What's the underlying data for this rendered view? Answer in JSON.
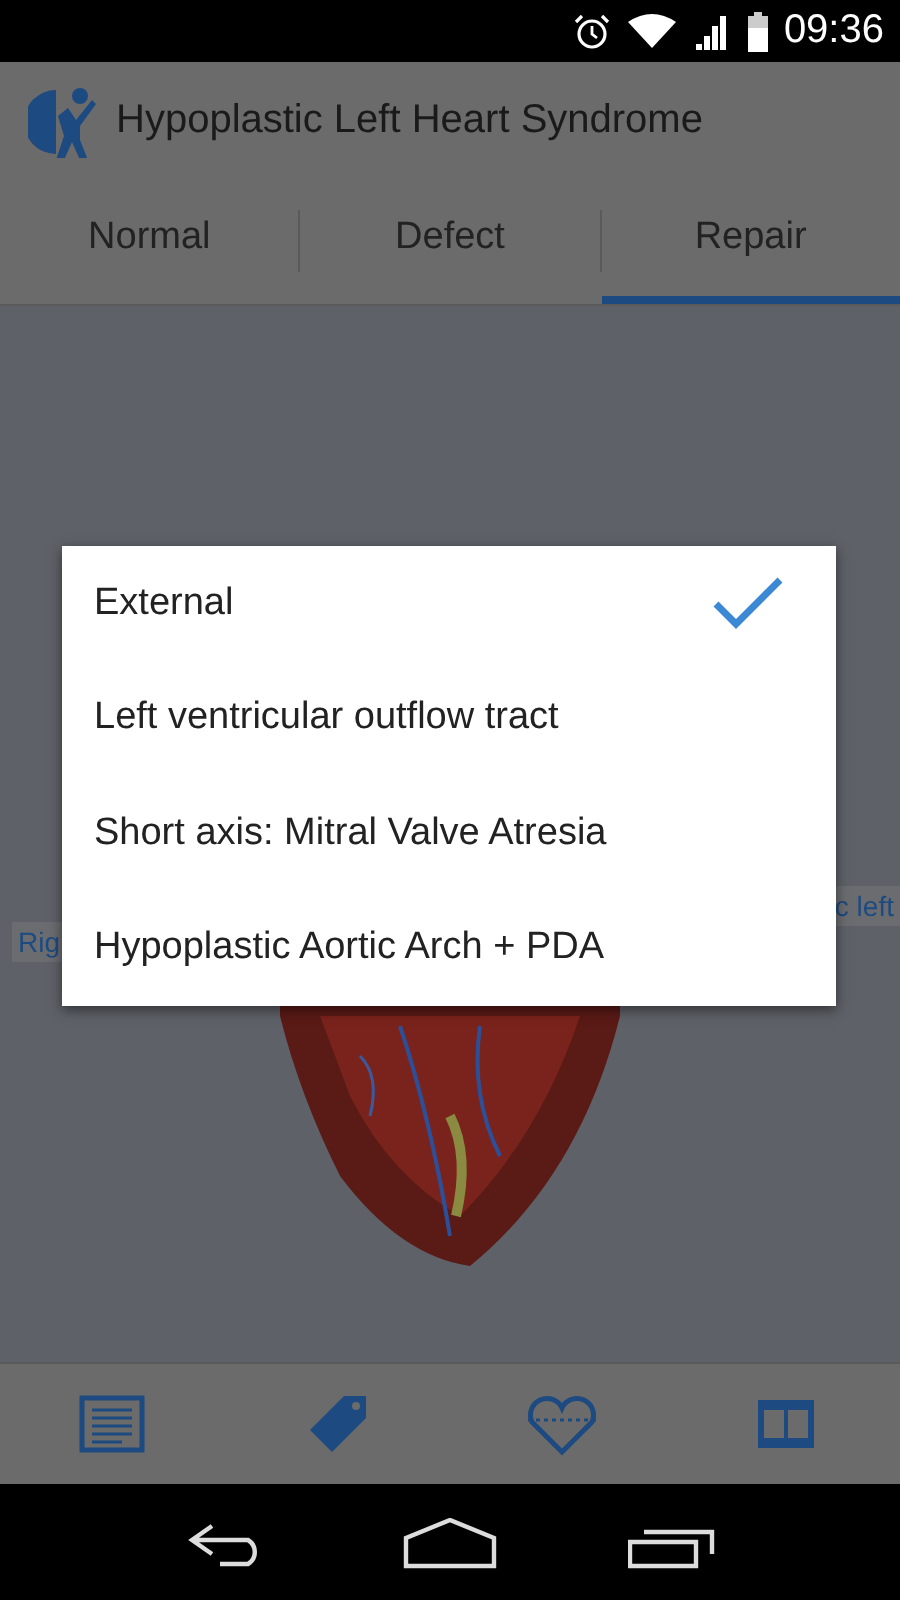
{
  "status_bar": {
    "time": "09:36"
  },
  "app_bar": {
    "title": "Hypoplastic Left Heart Syndrome"
  },
  "tabs": [
    {
      "label": "Normal",
      "selected": false
    },
    {
      "label": "Defect",
      "selected": false
    },
    {
      "label": "Repair",
      "selected": true
    }
  ],
  "model_labels": [
    {
      "text": "Rig"
    },
    {
      "text": "c left"
    }
  ],
  "view_menu": {
    "items": [
      {
        "label": "External",
        "selected": true
      },
      {
        "label": "Left ventricular outflow tract",
        "selected": false
      },
      {
        "label": "Short axis: Mitral Valve Atresia",
        "selected": false
      },
      {
        "label": "Hypoplastic Aortic Arch + PDA",
        "selected": false
      }
    ]
  },
  "bottom_bar": {
    "items": [
      {
        "kind": "text"
      },
      {
        "kind": "tag"
      },
      {
        "kind": "heart"
      },
      {
        "kind": "film"
      }
    ]
  }
}
